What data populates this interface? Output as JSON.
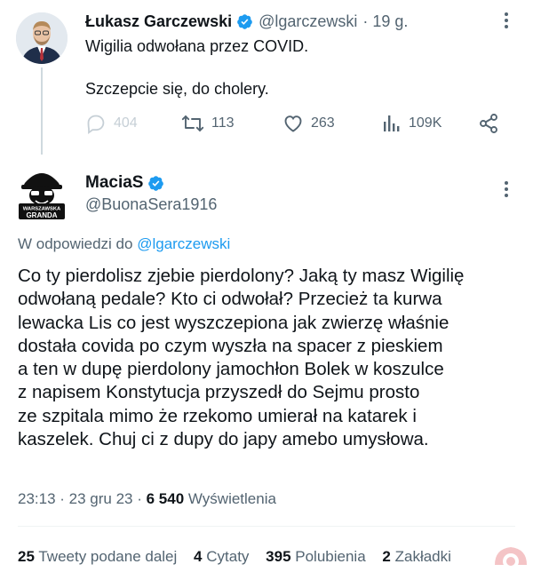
{
  "parent_tweet": {
    "author_name": "Łukasz Garczewski",
    "author_handle": "@lgarczewski",
    "time": "· 19 g.",
    "text_line1": "Wigilia odwołana przez COVID.",
    "text_line2": "Szczepcie się, do cholery.",
    "actions": {
      "replies": "404",
      "retweets": "113",
      "likes": "263",
      "views": "109K"
    }
  },
  "main_tweet": {
    "author_name": "MaciaS",
    "author_handle": "@BuonaSera1916",
    "avatar_text_top": "WARSZAWSKA",
    "avatar_text_bottom": "GRANDA",
    "reply_prefix": "W odpowiedzi do",
    "reply_mention": "@lgarczewski",
    "body_lines": [
      "Co ty pierdolisz zjebie pierdolony? Jaką ty masz Wigilię",
      "odwołaną pedale? Kto ci odwołał? Przecież ta kurwa",
      "lewacka Lis co jest wyszczepiona jak zwierzę właśnie",
      "dostała covida po czym wyszła na spacer z pieskiem",
      "a ten w dupę pierdolony jamochłon Bolek w koszulce",
      "z napisem Konstytucja przyszedł do Sejmu prosto",
      "ze szpitala mimo że rzekomo umierał na katarek i",
      "kaszelek. Chuj ci z dupy do japy amebo umysłowa."
    ],
    "timestamp": "23:13 · 23 gru 23 ·",
    "views_count": "6 540",
    "views_label": "Wyświetlenia",
    "stats": {
      "retweets_count": "25",
      "retweets_label": "Tweety podane dalej",
      "quotes_count": "4",
      "quotes_label": "Cytaty",
      "likes_count": "395",
      "likes_label": "Polubienia",
      "bookmarks_count": "2",
      "bookmarks_label": "Zakładki"
    }
  },
  "colors": {
    "text": "#0f1419",
    "secondary": "#536471",
    "accent": "#1d9bf0",
    "divider": "#eff3f4"
  },
  "icons": [
    "verified-badge-icon",
    "more-icon",
    "reply-icon",
    "retweet-icon",
    "like-icon",
    "views-icon",
    "share-icon"
  ]
}
